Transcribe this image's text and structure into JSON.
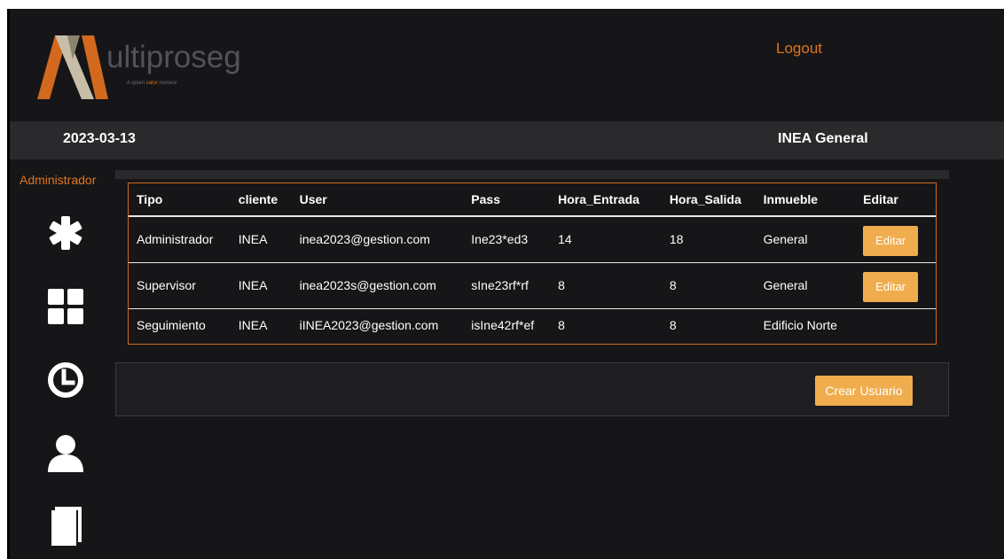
{
  "header": {
    "logo_word": "ultiproseg",
    "logo_tagline_pre": "A quien ",
    "logo_tagline_hl": "valor",
    "logo_tagline_post": " merece",
    "logout_label": "Logout"
  },
  "infobar": {
    "date": "2023-03-13",
    "client_title": "INEA General"
  },
  "sidebar": {
    "role_label": "Administrador",
    "icons": [
      "asterisk-icon",
      "grid-icon",
      "clock-icon",
      "user-icon",
      "book-icon"
    ]
  },
  "table": {
    "headers": [
      "Tipo",
      "cliente",
      "User",
      "Pass",
      "Hora_Entrada",
      "Hora_Salida",
      "Inmueble",
      "Editar"
    ],
    "rows": [
      {
        "tipo": "Administrador",
        "cliente": "INEA",
        "user": "inea2023@gestion.com",
        "pass": "Ine23*ed3",
        "entrada": "14",
        "salida": "18",
        "inmueble": "General",
        "edit": "Editar"
      },
      {
        "tipo": "Supervisor",
        "cliente": "INEA",
        "user": "inea2023s@gestion.com",
        "pass": "sIne23rf*rf",
        "entrada": "8",
        "salida": "8",
        "inmueble": "General",
        "edit": "Editar"
      },
      {
        "tipo": "Seguimiento",
        "cliente": "INEA",
        "user": "iINEA2023@gestion.com",
        "pass": "isIne42rf*ef",
        "entrada": "8",
        "salida": "8",
        "inmueble": "Edificio Norte",
        "edit": ""
      }
    ]
  },
  "actions": {
    "create_label": "Crear Usuario"
  },
  "colors": {
    "accent": "#e0761f",
    "button": "#f0ad4e",
    "background": "#161618"
  }
}
